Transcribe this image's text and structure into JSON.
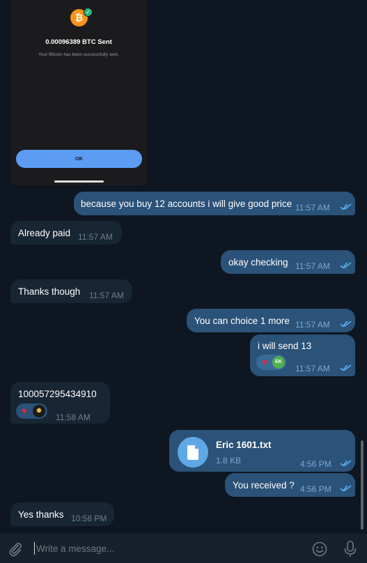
{
  "screenshot_card": {
    "coin_symbol": "₿",
    "amount_text": "0.00096389 BTC Sent",
    "subtitle": "Your Bitcoin has been successfully sent.",
    "ok_label": "OK"
  },
  "messages": [
    {
      "text": "because you buy 12 accounts i will give good price",
      "time": "11:57 AM"
    },
    {
      "text": "Already paid",
      "time": "11:57 AM"
    },
    {
      "text": "okay checking",
      "time": "11:57 AM"
    },
    {
      "text": "Thanks though",
      "time": "11:57 AM"
    },
    {
      "text": "You can choice 1 more",
      "time": "11:57 AM"
    },
    {
      "text": "i will send 13",
      "time": "11:57 AM",
      "reaction_initials": "EK"
    },
    {
      "text": "100057295434910",
      "time": "11:58 AM"
    },
    {
      "file_name": "Eric 1601.txt",
      "file_size": "1.8 KB",
      "time": "4:56 PM"
    },
    {
      "text": "You received ?",
      "time": "4:56 PM"
    },
    {
      "text": "Yes thanks",
      "time": "10:58 PM"
    }
  ],
  "composer": {
    "placeholder": "Write a message..."
  },
  "colors": {
    "background": "#0e1621",
    "outgoing_bubble": "#2b5278",
    "incoming_bubble": "#182533",
    "accent": "#5ea8e6"
  }
}
